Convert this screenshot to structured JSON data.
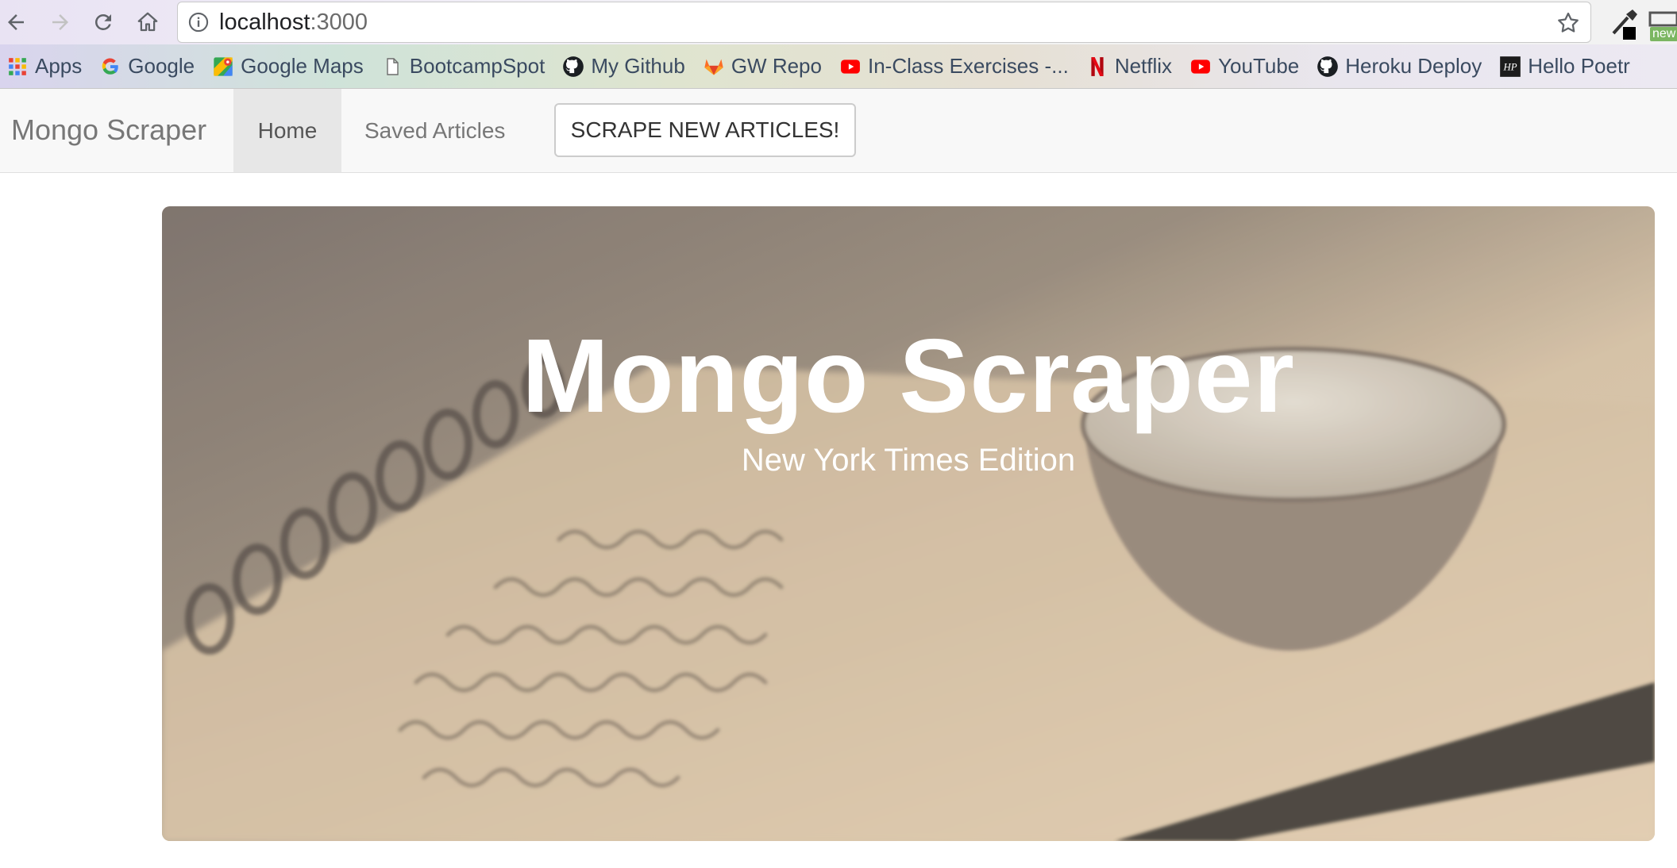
{
  "browser": {
    "url_host": "localhost",
    "url_port": ":3000",
    "extension_badge": "new",
    "bookmarks": [
      {
        "label": "Apps",
        "icon": "apps-grid-icon"
      },
      {
        "label": "Google",
        "icon": "google-icon"
      },
      {
        "label": "Google Maps",
        "icon": "google-maps-icon"
      },
      {
        "label": "BootcampSpot",
        "icon": "page-icon"
      },
      {
        "label": "My Github",
        "icon": "github-icon"
      },
      {
        "label": "GW Repo",
        "icon": "gitlab-icon"
      },
      {
        "label": "In-Class Exercises -...",
        "icon": "youtube-icon"
      },
      {
        "label": "Netflix",
        "icon": "netflix-icon"
      },
      {
        "label": "YouTube",
        "icon": "youtube-icon"
      },
      {
        "label": "Heroku Deploy",
        "icon": "github-icon"
      },
      {
        "label": "Hello Poetr",
        "icon": "hp-icon"
      }
    ]
  },
  "navbar": {
    "brand": "Mongo Scraper",
    "home": "Home",
    "saved": "Saved Articles",
    "scrape_button": "SCRAPE NEW ARTICLES!"
  },
  "hero": {
    "title": "Mongo Scraper",
    "subtitle": "New York Times Edition"
  }
}
